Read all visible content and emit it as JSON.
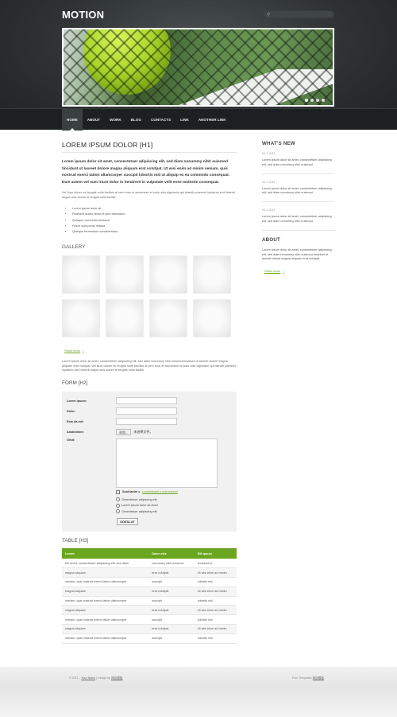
{
  "header": {
    "logo": "MOTION",
    "slider_dots": 4,
    "slider_active": 1
  },
  "nav": {
    "items": [
      "HOME",
      "ABOUT",
      "WORK",
      "BLOG",
      "CONTACTS",
      "LINK",
      "ANOTHER LINK"
    ],
    "active": "HOME"
  },
  "main": {
    "title": "LOREM IPSUM DOLOR [H1]",
    "lead": "Lorem ipsum dolor sit amet, consectetuer adipiscing elit, sed diam nonummy nibh euismod tincidunt ut laoreet dolore magna aliquam erat volutpat. Ut wisi enim ad minim veniam, quis nostrud exerci tation ullamcorper suscipit lobortis nisl ut aliquip ex ea commodo consequat. Duis autem vel eum iriure dolor in hendrerit in vulputate velit esse molestie consequat.",
    "paragraph": "Vel illum dolore eu feugiat nulla facilisis at vero eros et accumsan et iusto odio dignissim qui blandit praesent luptatum zzril delenit augue duis dolore te feugait nulla facilisi.",
    "bullets": [
      "Lorem ipsum dolor sit",
      "Praesent auctor tellor et sem bibendum",
      "Quisque commodo tincidunt",
      "Fusce quis purus massa",
      "Quisque fermentum condimentum"
    ],
    "gallery_title": "GALLERY",
    "show_more": "Show more",
    "paragraph2": "Lorem ipsum dolor sit amet, consectetuer adipiscing elit, sed diam nonummy nibh euismod tincidunt ut laoreet dolore magna aliquam erat volutpat. Vel illum dolore eu feugiat nulla facilisis at vero eros et accumsan et iusto odio dignissim qui blandit praesent luptatum zzril delenit augue duis dolore te feugait nulla facilisi.",
    "form_title": "FORM [H2]",
    "form": {
      "labels": [
        "Lorem ipsum:",
        "Dolor:",
        "Este da mit:",
        "Amatnimim:",
        "Orbit:"
      ],
      "file_button": "浏览...",
      "file_status": "未选择文件。",
      "checkbox_label": "Souhlasim s",
      "checkbox_link": "podminkami o ochrankami",
      "radios": [
        "Onsectetuer adipiscing elit",
        "Lorem ipsum dolor sit amet",
        "Onsectetuer adipiscing elit"
      ],
      "submit": "ODESLAT"
    },
    "table_title": "TABLE [H3]",
    "table": {
      "headers": [
        "Lorem",
        "Dolor este",
        "Elit ipsum"
      ],
      "rows": [
        [
          "Elit amet, consectetuer adipiscing elit, sed diam",
          "nonummy nibh euismod",
          "tincidunt ut"
        ],
        [
          "magna aliquam",
          "erat volutpat.",
          "Ut wisi enim ad minim"
        ],
        [
          "veniam, quis nostrud exerci tation ullamcorper",
          "suscipit",
          "lobortis nisl"
        ],
        [
          "magna aliquam",
          "erat volutpat.",
          "Ut wisi enim ad minim"
        ],
        [
          "veniam, quis nostrud exerci tation ullamcorper",
          "suscipit",
          "lobortis nisl"
        ],
        [
          "magna aliquam",
          "erat volutpat.",
          "Ut wisi enim ad minim"
        ],
        [
          "veniam, quis nostrud exerci tation ullamcorper",
          "suscipit",
          "lobortis nisl"
        ],
        [
          "magna aliquam",
          "erat volutpat.",
          "Ut wisi enim ad minim"
        ],
        [
          "veniam, quis nostrud exerci tation ullamcorper",
          "suscipit",
          "lobortis nisl"
        ]
      ]
    }
  },
  "side": {
    "news_title": "WHAT'S NEW",
    "news": [
      {
        "date": "20.1.2011",
        "text": "Lorem ipsum dolor sit amet, consectetuer adipiscing elit, sed diam nonummy nibh euismod."
      },
      {
        "date": "20.1.2011",
        "text": "Lorem ipsum dolor sit amet, consectetuer adipiscing elit, sed diam nonummy nibh euismod."
      },
      {
        "date": "20.1.2011",
        "text": "Lorem ipsum dolor sit amet, consectetuer adipiscing elit, sed diam nonummy nibh euismod."
      }
    ],
    "about_title": "ABOUT",
    "about_text": "Lorem ipsum dolor sit amet, consectetuer adipiscing elit, sed diam nonummy nibh euismod tincidunt ut laoreet dolore magna aliquam erat volutpat.",
    "show_more": "Show more"
  },
  "footer": {
    "left_text": "© 2011 – ",
    "left_link": "Your Name",
    "left_mid": " | Design by ",
    "left_design": "网页模板",
    "right_text": "Free Templates ",
    "right_link": "网页模板"
  },
  "colors": {
    "accent": "#6aa71e",
    "header_bg": "#2d3131",
    "nav_bg": "#1d2020"
  }
}
